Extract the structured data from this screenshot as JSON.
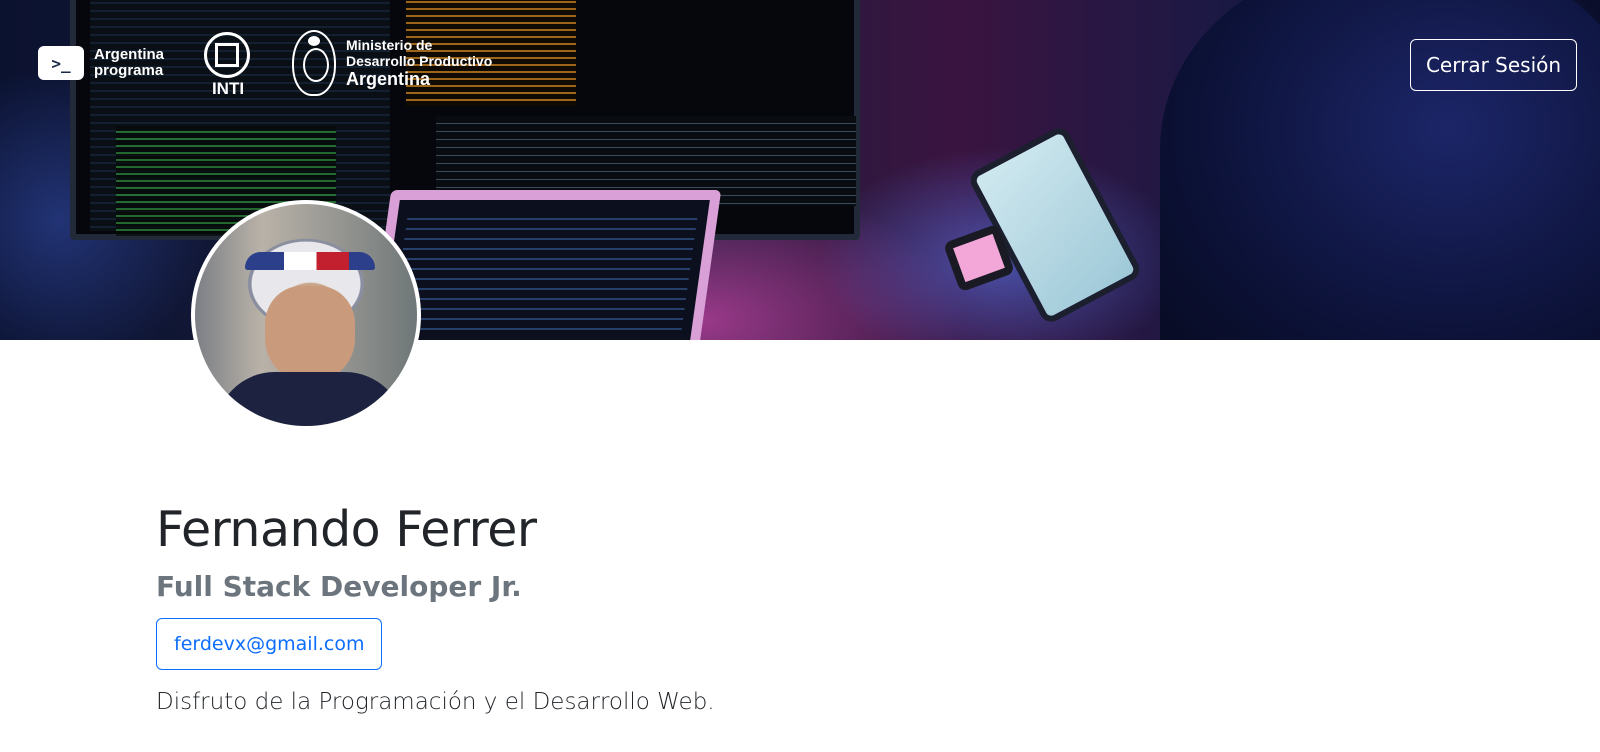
{
  "header": {
    "logos": {
      "argentina_programa": {
        "icon": "terminal-icon",
        "glyph": ">_",
        "line1": "Argentina",
        "line2": "programa"
      },
      "inti": {
        "icon": "inti-logo-icon",
        "text": "INTI"
      },
      "ministerio": {
        "icon": "coat-of-arms-icon",
        "line1": "Ministerio de",
        "line2": "Desarrollo Productivo",
        "line3": "Argentina"
      }
    },
    "logout_label": "Cerrar Sesión"
  },
  "profile": {
    "name": "Fernando Ferrer",
    "role": "Full Stack Developer Jr.",
    "email": "ferdevx@gmail.com",
    "bio": "Disfruto de la Programación y el Desarrollo Web."
  },
  "colors": {
    "primary": "#0d6efd",
    "text": "#212529",
    "muted": "#6c757d",
    "white": "#ffffff"
  }
}
